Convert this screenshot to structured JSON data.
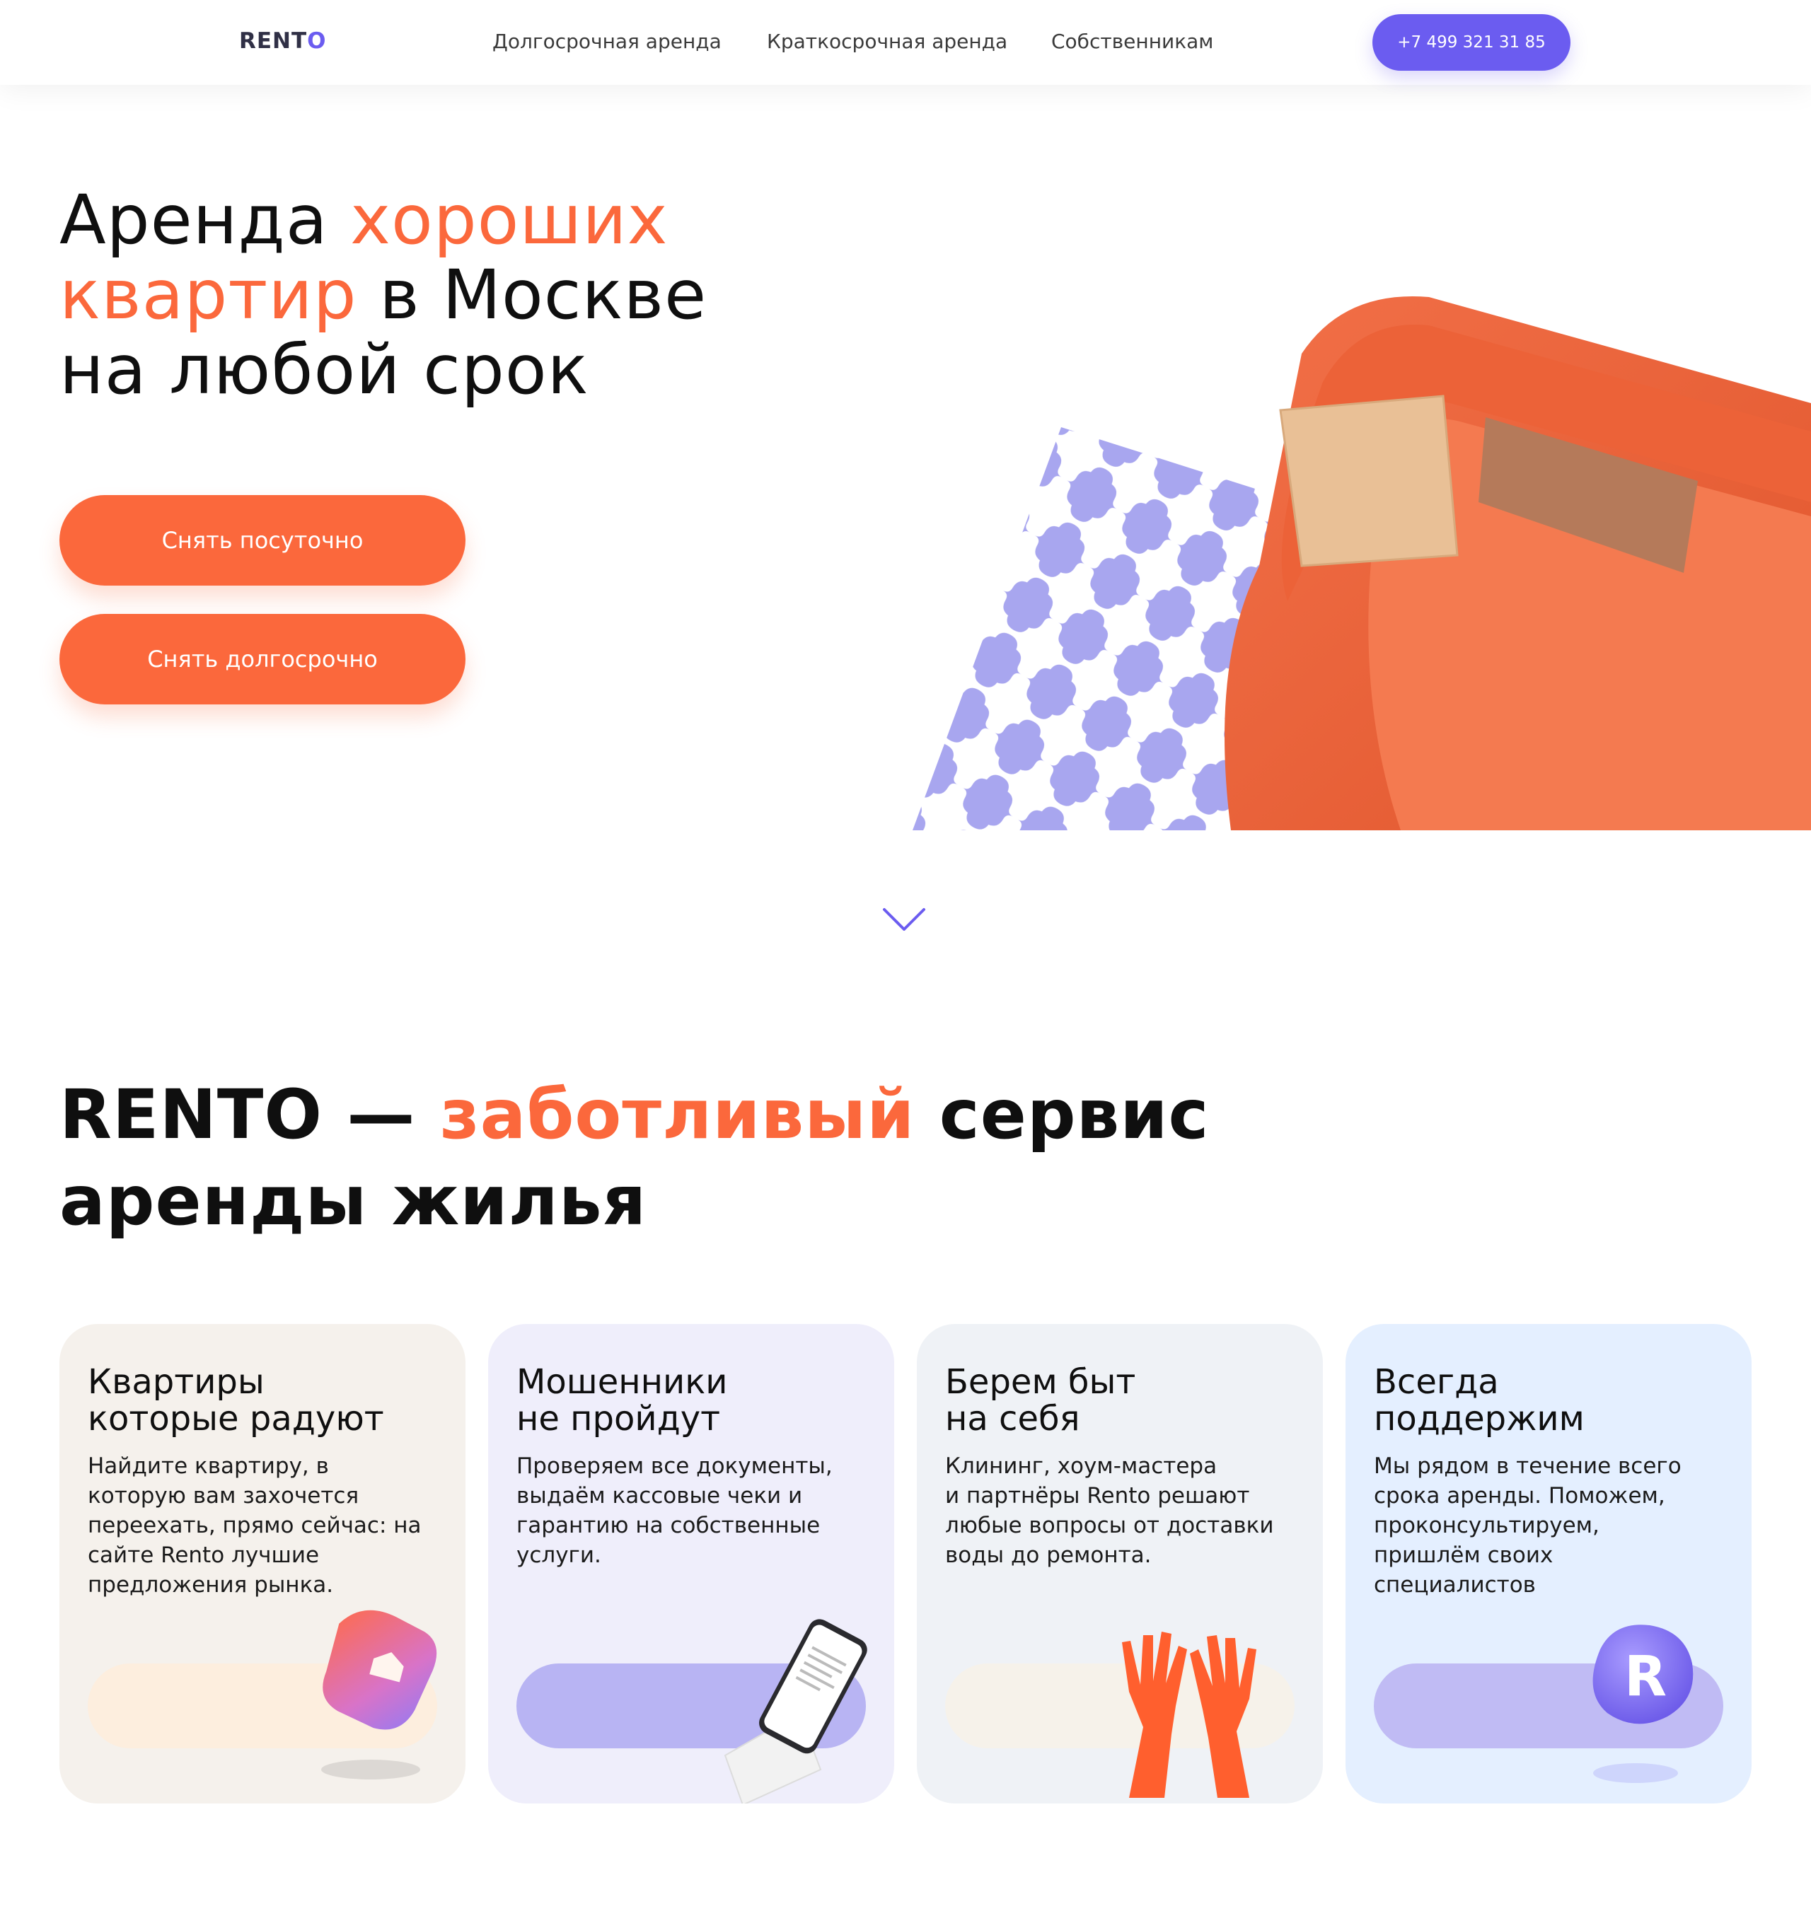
{
  "header": {
    "logo_main": "RENT",
    "logo_accent": "O",
    "nav": [
      "Долгосрочная аренда",
      "Краткосрочная аренда",
      "Собственникам"
    ],
    "phone": "+7 499 321 31 85"
  },
  "hero": {
    "title_line1_a": "Аренда ",
    "title_line1_b": "хороших",
    "title_line2_a": "квартир",
    "title_line2_b": " в Москве",
    "title_line3": "на любой срок",
    "cta_daily": "Снять посуточно",
    "cta_long": "Снять долгосрочно"
  },
  "about": {
    "title_a": "RENTO — ",
    "title_b": "заботливый",
    "title_c": " сервис",
    "title_line2": "аренды жилья"
  },
  "cards": [
    {
      "title": "Квартиры\nкоторые радуют",
      "text": "Найдите квартиру, в\nкоторую вам захочется\nпереехать, прямо сейчас: на\nсайте Rento лучшие\nпредложения рынка."
    },
    {
      "title": "Мошенники\nне пройдут",
      "text": "Проверяем все документы,\nвыдаём кассовые чеки и\nгарантию на собственные\nуслуги."
    },
    {
      "title": "Берем быт\nна себя",
      "text": "Клининг, хоум-мастера\nи партнёры Rento решают\nлюбые вопросы от доставки\nводы до ремонта."
    },
    {
      "title": "Всегда\nподдержим",
      "text": "Мы рядом в течение всего\nсрока аренды. Поможем,\nпроконсультируем,\nпришлём своих\nспециалистов"
    }
  ],
  "colors": {
    "accent_orange": "#fb683c",
    "accent_violet": "#6b5cf0",
    "text": "#0f0f0f"
  },
  "icons": [
    "chevron-down-icon",
    "house-badge-icon",
    "phone-receipt-icon",
    "gloves-icon",
    "rento-r-badge-icon"
  ]
}
